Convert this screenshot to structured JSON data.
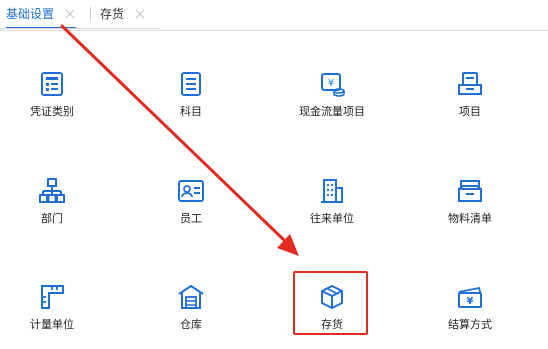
{
  "tabs": [
    {
      "label": "基础设置",
      "active": true
    },
    {
      "label": "存货",
      "active": false
    }
  ],
  "tiles": [
    {
      "label": "凭证类别",
      "icon": "voucher-category-icon"
    },
    {
      "label": "科目",
      "icon": "subject-list-icon"
    },
    {
      "label": "现金流量项目",
      "icon": "cash-flow-icon"
    },
    {
      "label": "项目",
      "icon": "project-tray-icon"
    },
    {
      "label": "部门",
      "icon": "department-org-icon"
    },
    {
      "label": "员工",
      "icon": "employee-card-icon"
    },
    {
      "label": "往来单位",
      "icon": "company-building-icon"
    },
    {
      "label": "物料清单",
      "icon": "material-box-icon"
    },
    {
      "label": "计量单位",
      "icon": "ruler-icon"
    },
    {
      "label": "仓库",
      "icon": "warehouse-icon"
    },
    {
      "label": "存货",
      "icon": "inventory-cube-icon"
    },
    {
      "label": "结算方式",
      "icon": "settlement-yen-icon"
    }
  ],
  "colors": {
    "accent": "#1f6fd6",
    "icon": "#1f6fd6",
    "annotation": "#e32a22"
  }
}
